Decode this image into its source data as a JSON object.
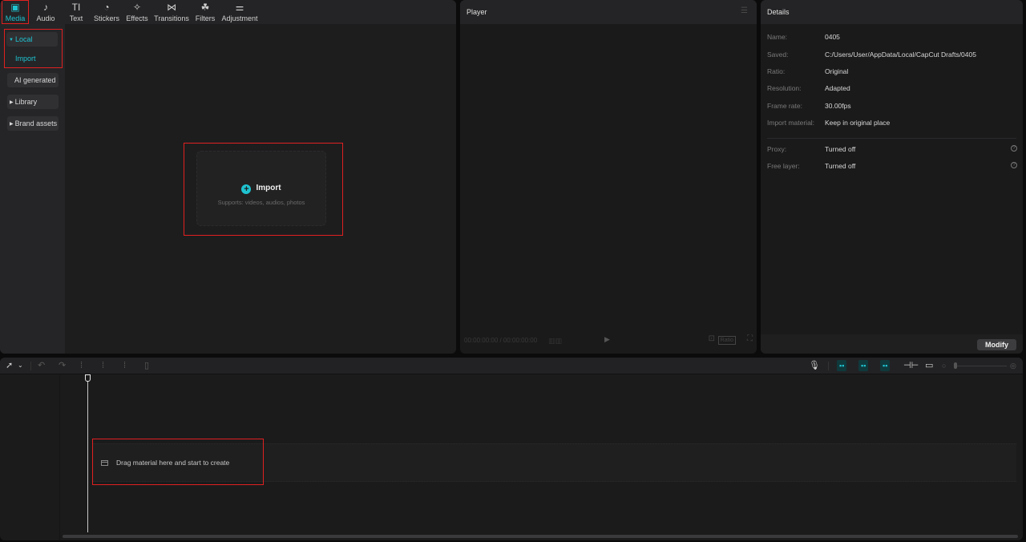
{
  "media": {
    "tabs": [
      {
        "label": "Media",
        "icon": "media-icon",
        "glyph": "▣",
        "active": true
      },
      {
        "label": "Audio",
        "icon": "audio-icon",
        "glyph": "♪"
      },
      {
        "label": "Text",
        "icon": "text-icon",
        "glyph": "TI"
      },
      {
        "label": "Stickers",
        "icon": "stickers-icon",
        "glyph": "◔"
      },
      {
        "label": "Effects",
        "icon": "effects-icon",
        "glyph": "✧"
      },
      {
        "label": "Transitions",
        "icon": "transitions-icon",
        "glyph": "⋈"
      },
      {
        "label": "Filters",
        "icon": "filters-icon",
        "glyph": "☘"
      },
      {
        "label": "Adjustment",
        "icon": "adjustment-icon",
        "glyph": "⚌"
      }
    ],
    "sidebar": {
      "local": "Local",
      "import": "Import",
      "ai_generated": "AI generated",
      "library": "Library",
      "brand_assets": "Brand assets"
    },
    "import_card": {
      "title": "Import",
      "subtitle": "Supports: videos, audios, photos"
    }
  },
  "player": {
    "title": "Player",
    "time": "00:00:00:00 / 00:00:00:00",
    "ratio_label": "Ratio"
  },
  "details": {
    "title": "Details",
    "rows": [
      {
        "key": "Name:",
        "value": "0405"
      },
      {
        "key": "Saved:",
        "value": "C:/Users/User/AppData/Local/CapCut Drafts/0405"
      },
      {
        "key": "Ratio:",
        "value": "Original"
      },
      {
        "key": "Resolution:",
        "value": "Adapted"
      },
      {
        "key": "Frame rate:",
        "value": "30.00fps"
      },
      {
        "key": "Import material:",
        "value": "Keep in original place"
      }
    ],
    "extra_rows": [
      {
        "key": "Proxy:",
        "value": "Turned off"
      },
      {
        "key": "Free layer:",
        "value": "Turned off"
      }
    ],
    "modify_label": "Modify"
  },
  "timeline": {
    "empty_hint": "Drag material here and start to create"
  },
  "colors": {
    "accent": "#1fc3d0",
    "highlight_box": "#e02020"
  }
}
